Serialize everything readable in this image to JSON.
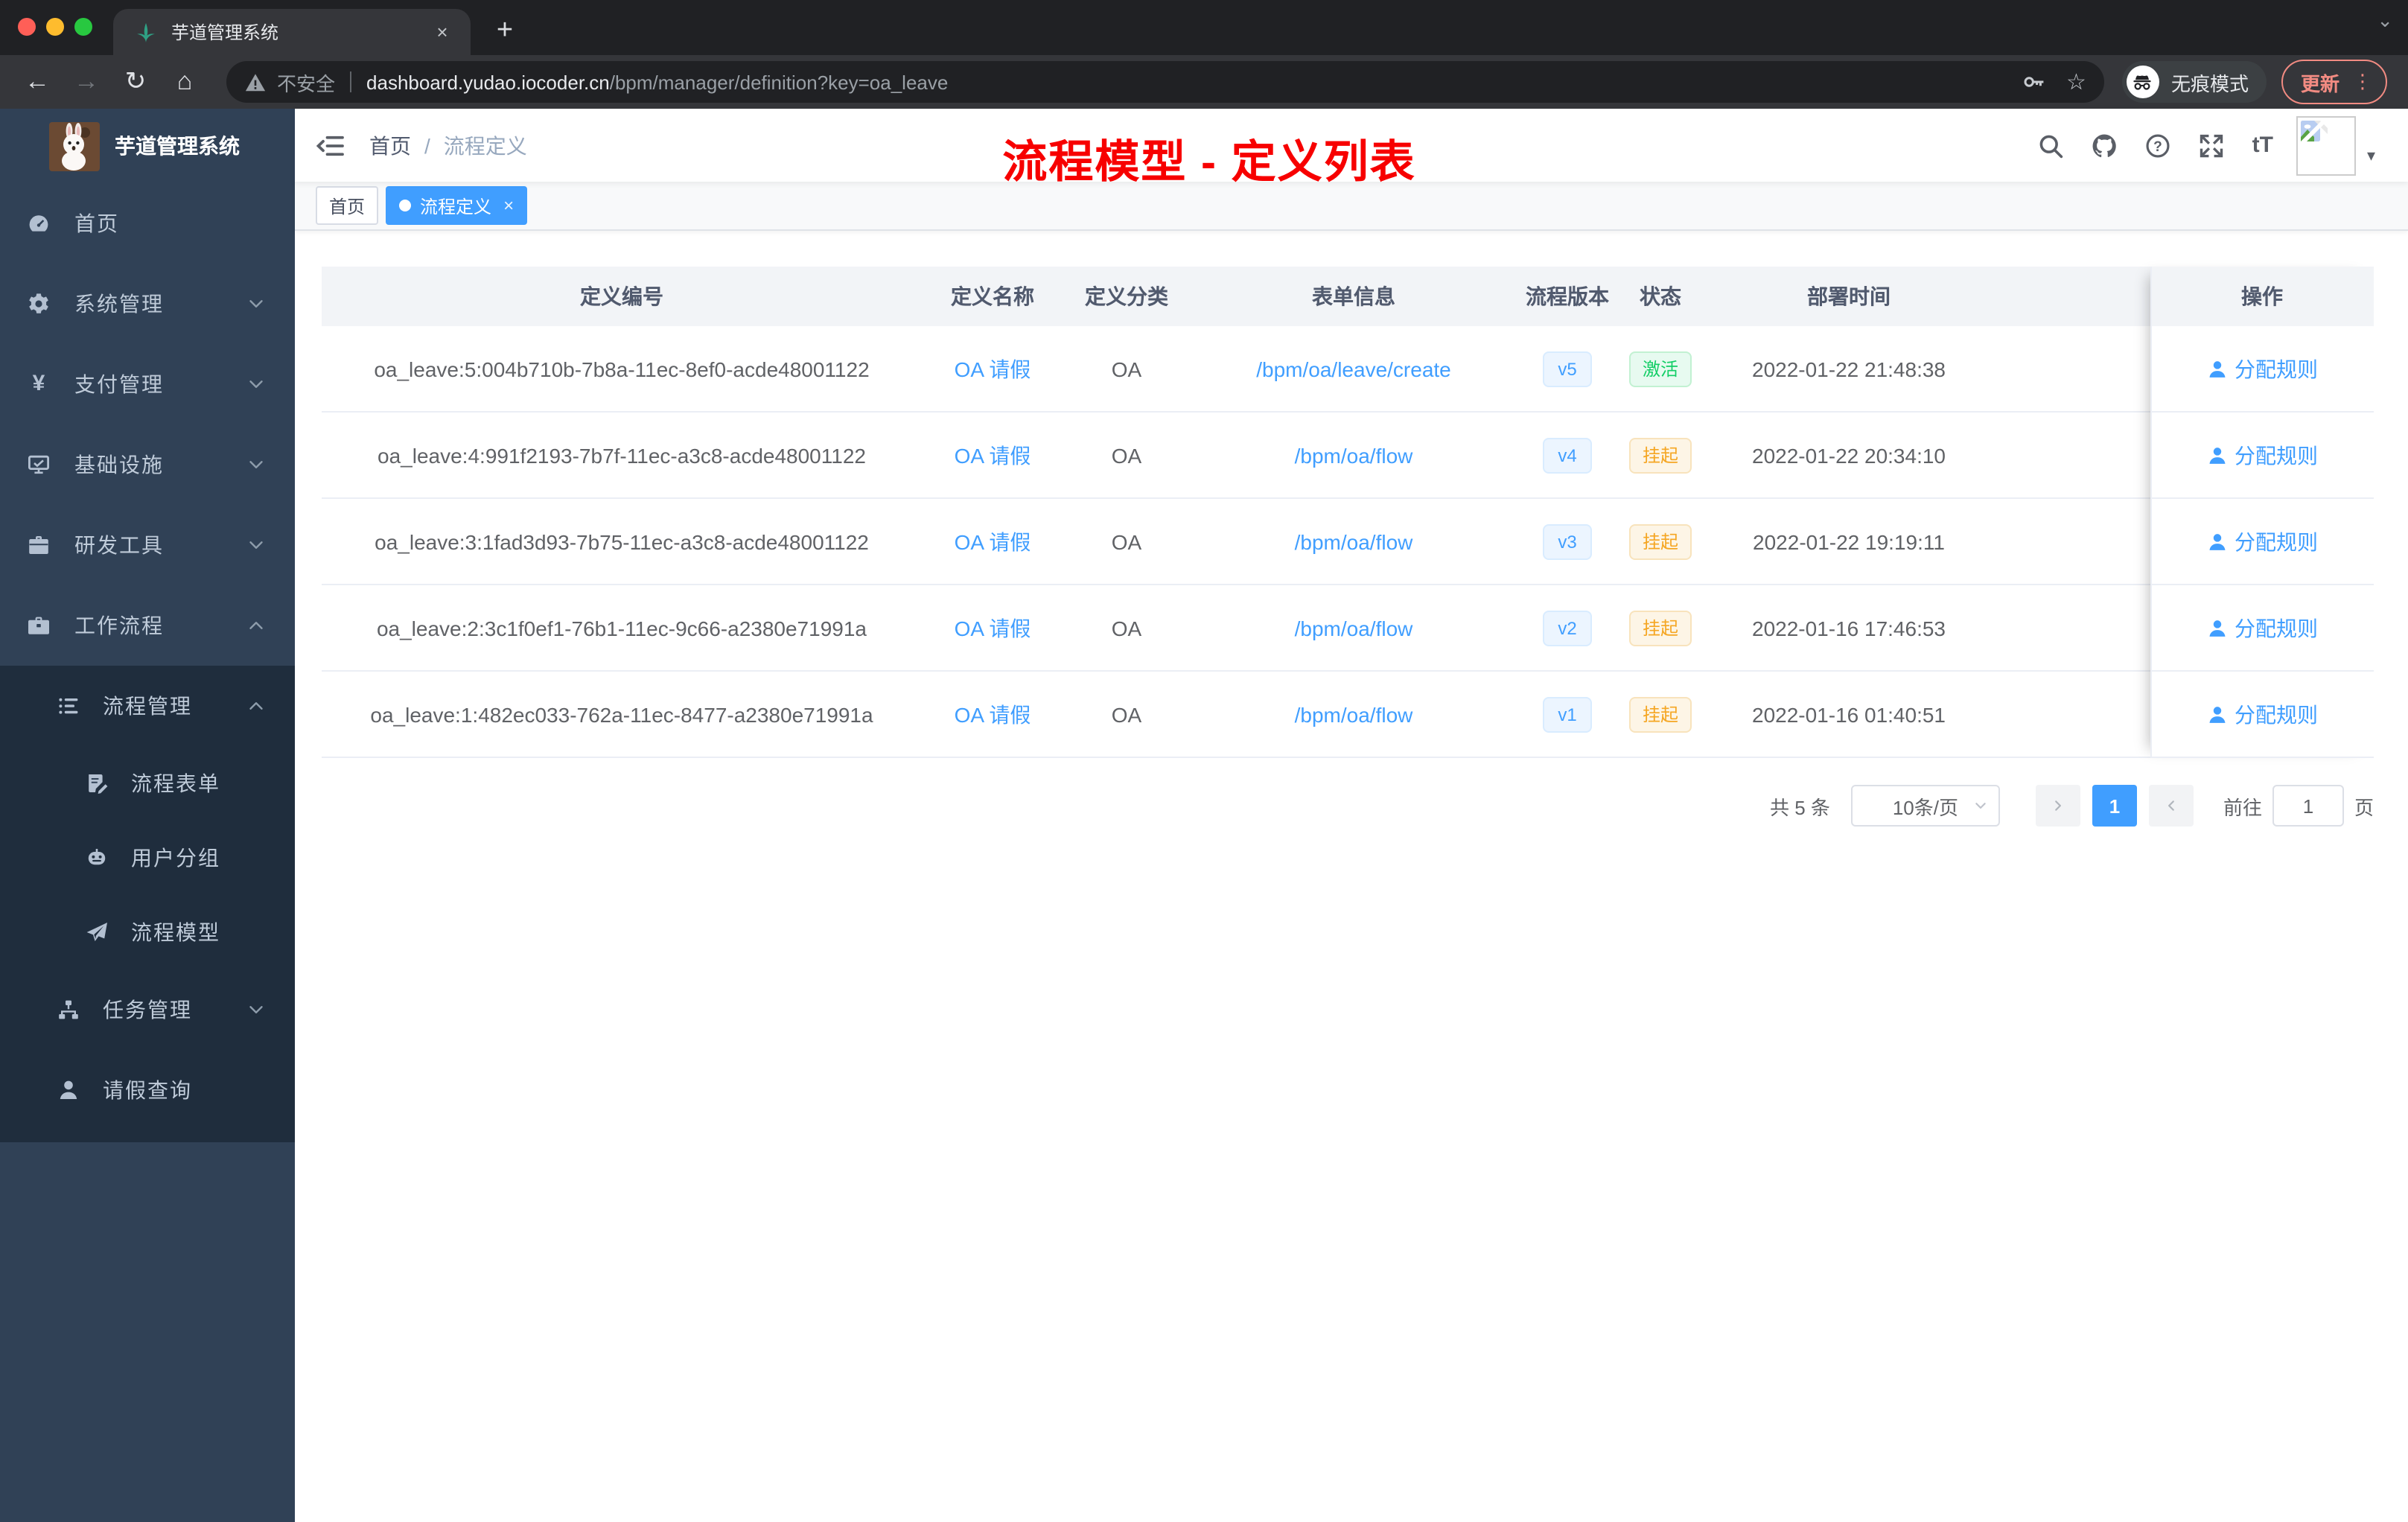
{
  "theme": {
    "accent": "#409eff",
    "success_green": "#13ce66",
    "warning_orange": "#f5a623",
    "annotation_red": "#f70000",
    "sidebar_bg": "#304156",
    "submenu_bg": "#1f2d3d"
  },
  "browser": {
    "tab": {
      "title": "芋道管理系统"
    },
    "glyphs": {
      "close": "×",
      "new_tab": "+",
      "tab_search": "⌄",
      "back": "←",
      "forward": "→",
      "reload": "↻",
      "home": "⌂",
      "star": "☆",
      "caret_down": "▾",
      "overflow_dots": "⋮"
    },
    "toolbar": {
      "insecure_label": "不安全",
      "url_host": "dashboard.yudao.iocoder.cn",
      "url_path": "/bpm/manager/definition?key=oa_leave",
      "incognito_label": "无痕模式",
      "update_label": "更新"
    }
  },
  "sidebar": {
    "title": "芋道管理系统",
    "items": [
      {
        "label": "首页"
      },
      {
        "label": "系统管理"
      },
      {
        "label": "支付管理"
      },
      {
        "label": "基础设施"
      },
      {
        "label": "研发工具"
      },
      {
        "label": "工作流程"
      },
      {
        "label": "流程管理"
      },
      {
        "label": "流程表单"
      },
      {
        "label": "用户分组"
      },
      {
        "label": "流程模型"
      },
      {
        "label": "任务管理"
      },
      {
        "label": "请假查询"
      }
    ]
  },
  "navbar": {
    "breadcrumb_home": "首页",
    "breadcrumb_sep": "/",
    "breadcrumb_current": "流程定义",
    "annotation": "流程模型 - 定义列表"
  },
  "tags": {
    "home": "首页",
    "active": "流程定义"
  },
  "table": {
    "columns": [
      "定义编号",
      "定义名称",
      "定义分类",
      "表单信息",
      "流程版本",
      "状态",
      "部署时间",
      "操作"
    ],
    "action_label": "分配规则",
    "rows": [
      {
        "id": "oa_leave:5:004b710b-7b8a-11ec-8ef0-acde48001122",
        "name": "OA 请假",
        "category": "OA",
        "form": "/bpm/oa/leave/create",
        "version": "v5",
        "status": "激活",
        "status_type": "success",
        "time": "2022-01-22 21:48:38"
      },
      {
        "id": "oa_leave:4:991f2193-7b7f-11ec-a3c8-acde48001122",
        "name": "OA 请假",
        "category": "OA",
        "form": "/bpm/oa/flow",
        "version": "v4",
        "status": "挂起",
        "status_type": "warning",
        "time": "2022-01-22 20:34:10"
      },
      {
        "id": "oa_leave:3:1fad3d93-7b75-11ec-a3c8-acde48001122",
        "name": "OA 请假",
        "category": "OA",
        "form": "/bpm/oa/flow",
        "version": "v3",
        "status": "挂起",
        "status_type": "warning",
        "time": "2022-01-22 19:19:11"
      },
      {
        "id": "oa_leave:2:3c1f0ef1-76b1-11ec-9c66-a2380e71991a",
        "name": "OA 请假",
        "category": "OA",
        "form": "/bpm/oa/flow",
        "version": "v2",
        "status": "挂起",
        "status_type": "warning",
        "time": "2022-01-16 17:46:53"
      },
      {
        "id": "oa_leave:1:482ec033-762a-11ec-8477-a2380e71991a",
        "name": "OA 请假",
        "category": "OA",
        "form": "/bpm/oa/flow",
        "version": "v1",
        "status": "挂起",
        "status_type": "warning",
        "time": "2022-01-16 01:40:51"
      }
    ]
  },
  "pagination": {
    "total": "共 5 条",
    "page_size": "10条/页",
    "page": "1",
    "goto_label": "前往",
    "goto_value": "1",
    "unit_label": "页"
  }
}
